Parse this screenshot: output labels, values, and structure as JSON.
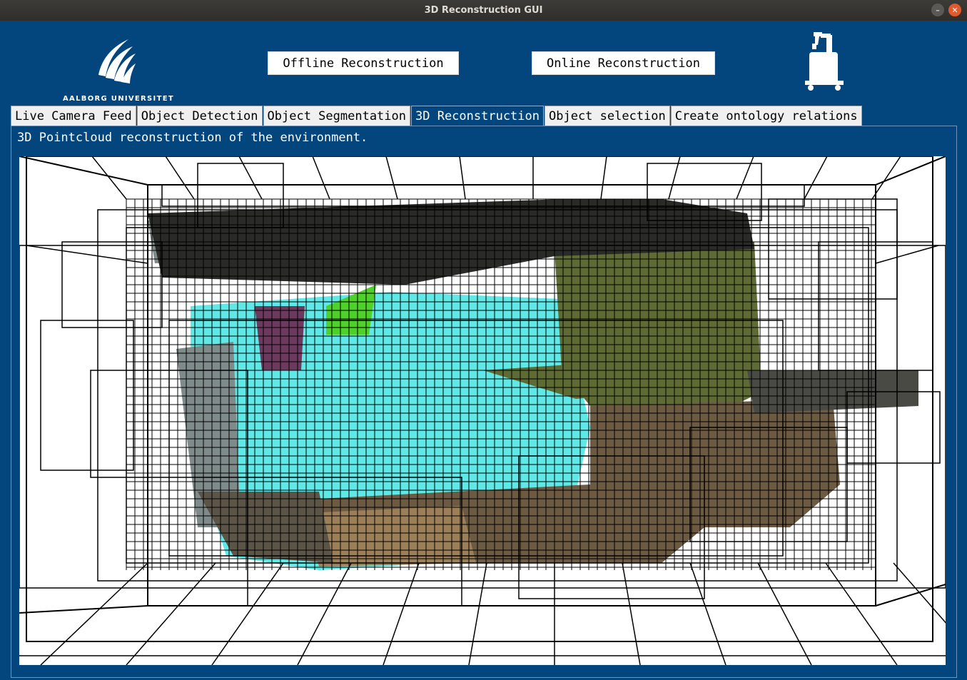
{
  "window": {
    "title": "3D Reconstruction GUI",
    "minimize_glyph": "–",
    "close_glyph": "✕"
  },
  "header": {
    "logo_text": "AALBORG UNIVERSITET",
    "offline_button": "Offline Reconstruction",
    "online_button": "Online Reconstruction",
    "robot_icon": "robot-icon"
  },
  "tabs": [
    {
      "label": "Live Camera Feed",
      "active": false
    },
    {
      "label": "Object Detection",
      "active": false
    },
    {
      "label": "Object Segmentation",
      "active": false
    },
    {
      "label": "3D Reconstruction",
      "active": true
    },
    {
      "label": "Object selection",
      "active": false
    },
    {
      "label": "Create ontology relations",
      "active": false
    }
  ],
  "panel": {
    "description": "3D Pointcloud reconstruction of the environment."
  },
  "colors": {
    "app_background": "#03457d",
    "cyan_region": "#5fe8e6",
    "olive_region": "#5e6b34",
    "brown_region": "#6d5a43",
    "tan_region": "#9b7f58",
    "purple_region": "#6b3a5e",
    "green_region": "#4fd12c",
    "gray_region": "#7f8a8a"
  }
}
